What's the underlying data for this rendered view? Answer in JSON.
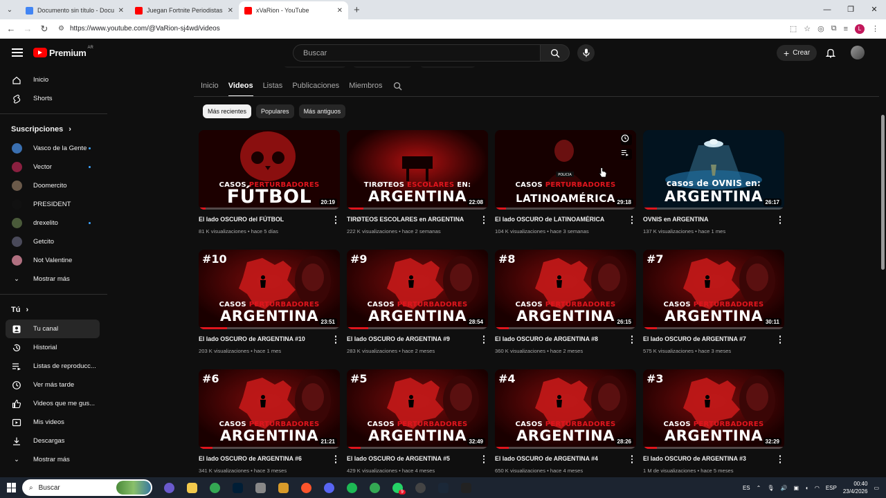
{
  "browser": {
    "tabs": [
      {
        "title": "Documento sin título - Docum",
        "icon": "google-docs-icon",
        "color": "#4285f4",
        "active": false
      },
      {
        "title": "Juegan Fortnite Periodistas de",
        "icon": "youtube-icon",
        "color": "#ff0000",
        "active": false
      },
      {
        "title": "xVaRion - YouTube",
        "icon": "youtube-icon",
        "color": "#ff0000",
        "active": true
      }
    ],
    "new_tab": "+",
    "url": "https://www.youtube.com/@VaRion-sj4wd/videos",
    "profile_initial": "L"
  },
  "youtube": {
    "logo_text": "Premium",
    "country_code": "AR",
    "search_placeholder": "Buscar",
    "create_label": "Crear"
  },
  "sidebar": {
    "main": [
      {
        "label": "Inicio",
        "icon": "home-icon"
      },
      {
        "label": "Shorts",
        "icon": "shorts-icon"
      }
    ],
    "subscriptions_title": "Suscripciones",
    "subscriptions": [
      {
        "label": "Vasco de la Gente",
        "color": "#3a6fb0",
        "live": true
      },
      {
        "label": "Vector",
        "color": "#8a2040",
        "live": true
      },
      {
        "label": "Doomercito",
        "color": "#6b5a4a",
        "live": false
      },
      {
        "label": "PRESIDENT",
        "color": "#111111",
        "live": false
      },
      {
        "label": "drexelito",
        "color": "#4a5a3a",
        "live": true
      },
      {
        "label": "Getcito",
        "color": "#4a4a5a",
        "live": false
      },
      {
        "label": "Not Valentine",
        "color": "#b07080",
        "live": false
      }
    ],
    "show_more_subs": "Mostrar más",
    "you_title": "Tú",
    "you": [
      {
        "label": "Tu canal",
        "icon": "channel-icon",
        "selected": true
      },
      {
        "label": "Historial",
        "icon": "history-icon",
        "selected": false
      },
      {
        "label": "Listas de reproducc...",
        "icon": "playlists-icon",
        "selected": false
      },
      {
        "label": "Ver más tarde",
        "icon": "watch-later-icon",
        "selected": false
      },
      {
        "label": "Videos que me gus...",
        "icon": "like-icon",
        "selected": false
      },
      {
        "label": "Mis videos",
        "icon": "my-videos-icon",
        "selected": false
      },
      {
        "label": "Descargas",
        "icon": "download-icon",
        "selected": false
      }
    ],
    "show_more_you": "Mostrar más"
  },
  "channel_tabs": [
    "Inicio",
    "Videos",
    "Listas",
    "Publicaciones",
    "Miembros"
  ],
  "active_channel_tab": "Videos",
  "filters": [
    {
      "label": "Más recientes",
      "active": true
    },
    {
      "label": "Populares",
      "active": false
    },
    {
      "label": "Más antiguos",
      "active": false
    }
  ],
  "videos": [
    {
      "title": "El lado OSCURO del FÚTBOL",
      "meta": "81 K visualizaciones • hace 5 días",
      "duration": "20:19",
      "num": "",
      "line1a": "CASOS ",
      "line1b": "PERTURBADORES",
      "line1c": "",
      "line2": "FÚTBOL",
      "style": "skull",
      "progress": 0.05
    },
    {
      "title": "TIRØTEOS ESCOLARES en ARGENTINA",
      "meta": "222 K visualizaciones • hace 2 semanas",
      "duration": "22:08",
      "num": "",
      "line1a": "TIRØTEOS ",
      "line1b": "ESCOLARES",
      "line1c": " EN:",
      "line2": "ARGENTINA",
      "style": "desk",
      "progress": 0.12
    },
    {
      "title": "El lado OSCURO de LATINOAMÉRICA",
      "meta": "104 K visualizaciones • hace 3 semanas",
      "duration": "29:18",
      "num": "",
      "line1a": "CASOS ",
      "line1b": "PERTURBADORES",
      "line1c": "",
      "line2": "LATINOAMÉRICA",
      "style": "police",
      "progress": 0.08
    },
    {
      "title": "OVNIS en ARGENTINA",
      "meta": "137 K visualizaciones • hace 1 mes",
      "duration": "26:17",
      "num": "",
      "line1a": "casos de OVNIS en:",
      "line1b": "",
      "line1c": "",
      "line2": "ARGENTINA",
      "style": "ufo",
      "progress": 0.1
    },
    {
      "title": "El lado OSCURO de ARGENTINA #10",
      "meta": "203 K visualizaciones • hace 1 mes",
      "duration": "23:51",
      "num": "#10",
      "line1a": "CASOS ",
      "line1b": "PERTURBADORES",
      "line1c": "",
      "line2": "ARGENTINA",
      "style": "map",
      "progress": 0.2
    },
    {
      "title": "El lado OSCURO de ARGENTINA #9",
      "meta": "283 K visualizaciones • hace 2 meses",
      "duration": "28:54",
      "num": "#9",
      "line1a": "CASOS ",
      "line1b": "PERTURBADORES",
      "line1c": "",
      "line2": "ARGENTINA",
      "style": "map",
      "progress": 0.15
    },
    {
      "title": "El lado OSCURO de ARGENTINA #8",
      "meta": "360 K visualizaciones • hace 2 meses",
      "duration": "26:15",
      "num": "#8",
      "line1a": "CASOS ",
      "line1b": "PERTURBADORES",
      "line1c": "",
      "line2": "ARGENTINA",
      "style": "map",
      "progress": 0.1
    },
    {
      "title": "El lado OSCURO de ARGENTINA #7",
      "meta": "575 K visualizaciones • hace 3 meses",
      "duration": "30:11",
      "num": "#7",
      "line1a": "CASOS ",
      "line1b": "PERTURBADORES",
      "line1c": "",
      "line2": "ARGENTINA",
      "style": "map",
      "progress": 0.1
    },
    {
      "title": "El lado OSCURO de ARGENTINA #6",
      "meta": "341 K visualizaciones • hace 3 meses",
      "duration": "21:21",
      "num": "#6",
      "line1a": "CASOS ",
      "line1b": "PERTURBADORES",
      "line1c": "",
      "line2": "ARGENTINA",
      "style": "map",
      "progress": 0.1
    },
    {
      "title": "El lado OSCURO de ARGENTINA #5",
      "meta": "429 K visualizaciones • hace 4 meses",
      "duration": "32:49",
      "num": "#5",
      "line1a": "CASOS ",
      "line1b": "PERTURBADORES",
      "line1c": "",
      "line2": "ARGENTINA",
      "style": "map",
      "progress": 0.1
    },
    {
      "title": "El lado OSCURO de ARGENTINA #4",
      "meta": "650 K visualizaciones • hace 4 meses",
      "duration": "28:26",
      "num": "#4",
      "line1a": "CASOS ",
      "line1b": "PERTURBADORES",
      "line1c": "",
      "line2": "ARGENTINA",
      "style": "map",
      "progress": 0.1
    },
    {
      "title": "El lado OSCURO de ARGENTINA #3",
      "meta": "1 M de visualizaciones • hace 5 meses",
      "duration": "32:29",
      "num": "#3",
      "line1a": "CASOS ",
      "line1b": "PERTURBADORES",
      "line1c": "",
      "line2": "ARGENTINA",
      "style": "map",
      "progress": 0.1
    }
  ],
  "taskbar": {
    "search_label": "Buscar",
    "apps": [
      {
        "icon": "copilot-icon",
        "color": "#6a5acd"
      },
      {
        "icon": "file-explorer-icon",
        "color": "#f2c94c"
      },
      {
        "icon": "chrome-icon",
        "color": "#34a853"
      },
      {
        "icon": "photoshop-icon",
        "color": "#001e36"
      },
      {
        "icon": "app-icon",
        "color": "#888888"
      },
      {
        "icon": "app-icon",
        "color": "#d89b2a"
      },
      {
        "icon": "brave-icon",
        "color": "#fb542b"
      },
      {
        "icon": "discord-icon",
        "color": "#5865f2"
      },
      {
        "icon": "spotify-icon",
        "color": "#1db954"
      },
      {
        "icon": "chrome-icon",
        "color": "#34a853"
      },
      {
        "icon": "whatsapp-icon",
        "color": "#25d366"
      },
      {
        "icon": "obs-icon",
        "color": "#444444"
      },
      {
        "icon": "steam-icon",
        "color": "#1b2838"
      },
      {
        "icon": "media-player-icon",
        "color": "#222222"
      }
    ],
    "badge": "9",
    "lang_top": "ES",
    "lang": "ESP",
    "time": "00:40",
    "date": "23/4/2026"
  }
}
